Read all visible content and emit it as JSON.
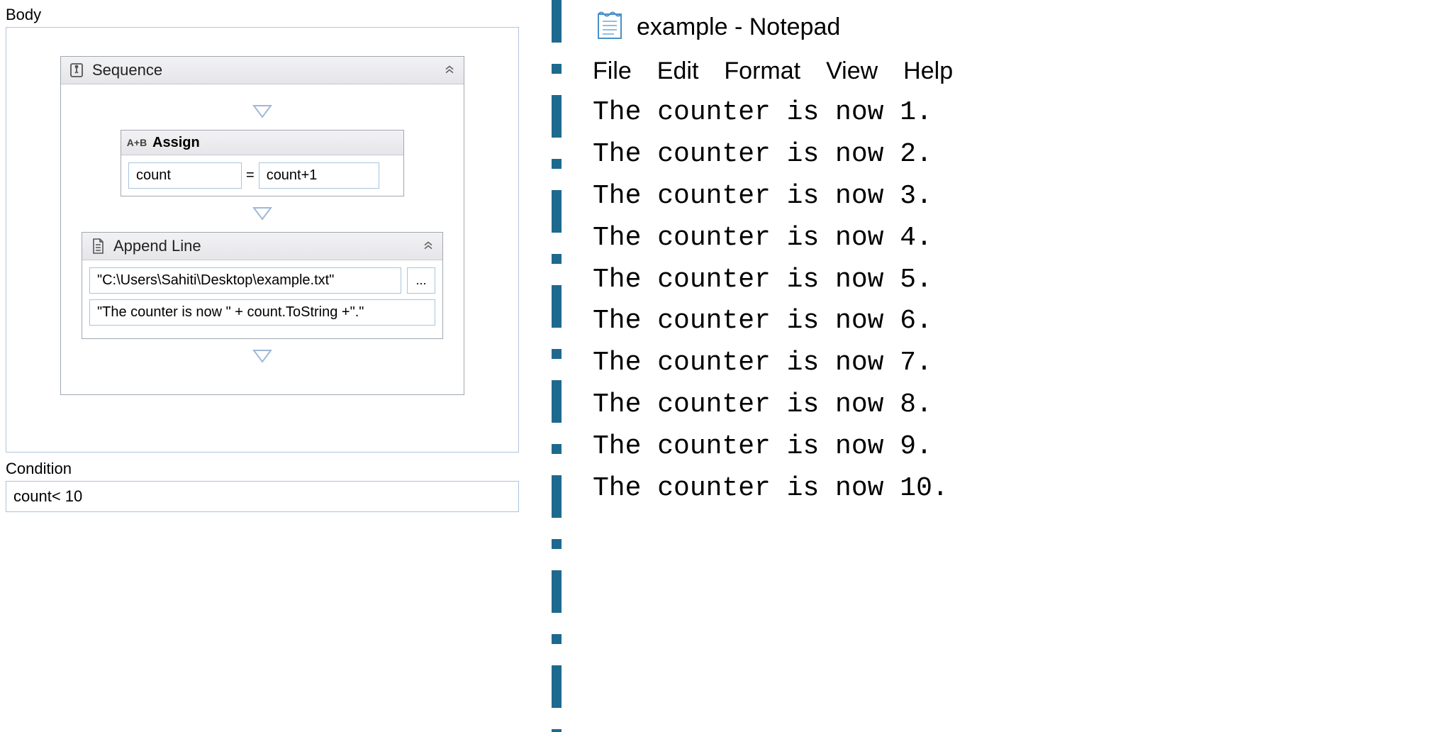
{
  "left": {
    "body_label": "Body",
    "sequence_title": "Sequence",
    "assign_title": "Assign",
    "assign_badge": "A+B",
    "assign_target": "count",
    "assign_equals": "=",
    "assign_value": "count+1",
    "append_title": "Append Line",
    "append_path": "\"C:\\Users\\Sahiti\\Desktop\\example.txt\"",
    "append_text": "\"The counter is now \" + count.ToString +\".\"",
    "browse_label": "...",
    "condition_label": "Condition",
    "condition_value": "count< 10"
  },
  "notepad": {
    "title": "example - Notepad",
    "menu": {
      "file": "File",
      "edit": "Edit",
      "format": "Format",
      "view": "View",
      "help": "Help"
    },
    "lines": [
      "The counter is now 1.",
      "The counter is now 2.",
      "The counter is now 3.",
      "The counter is now 4.",
      "The counter is now 5.",
      "The counter is now 6.",
      "The counter is now 7.",
      "The counter is now 8.",
      "The counter is now 9.",
      "The counter is now 10."
    ]
  }
}
